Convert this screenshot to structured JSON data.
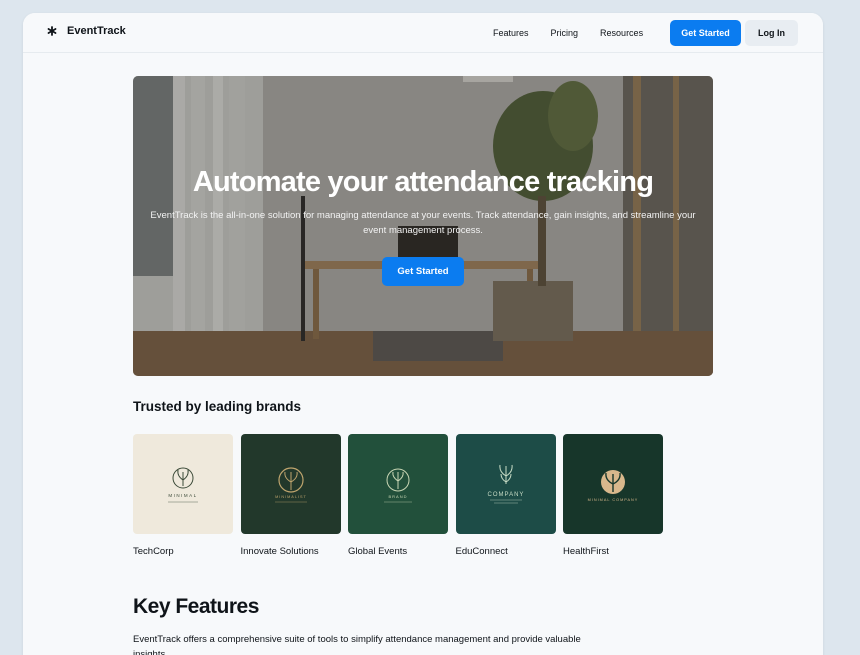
{
  "app": {
    "name": "EventTrack"
  },
  "nav": {
    "links": [
      "Features",
      "Pricing",
      "Resources"
    ],
    "primary_cta": "Get Started",
    "login": "Log In"
  },
  "hero": {
    "title": "Automate your attendance tracking",
    "subtitle": "EventTrack is the all-in-one solution for managing attendance at your events. Track attendance, gain insights, and streamline your event management process.",
    "cta": "Get Started"
  },
  "brands": {
    "heading": "Trusted by leading brands",
    "items": [
      {
        "name": "TechCorp",
        "tile_color": "#efe9dc",
        "logo_text": "MINIMAL",
        "logo_color": "#3b4a38"
      },
      {
        "name": "Innovate Solutions",
        "tile_color": "#22382b",
        "logo_text": "MINIMALIST",
        "logo_color": "#bfa56e"
      },
      {
        "name": "Global Events",
        "tile_color": "#22503b",
        "logo_text": "BRAND",
        "logo_color": "#c8d6b4"
      },
      {
        "name": "EduConnect",
        "tile_color": "#1d4c47",
        "logo_text": "COMPANY",
        "logo_color": "#c8dcc6"
      },
      {
        "name": "HealthFirst",
        "tile_color": "#17362a",
        "logo_text": "MINIMAL COMPANY",
        "logo_color": "#d8b88c"
      }
    ]
  },
  "features": {
    "heading": "Key Features",
    "description": "EventTrack offers a comprehensive suite of tools to simplify attendance management and provide valuable insights."
  },
  "colors": {
    "accent": "#0b7cf0",
    "page_bg": "#dde6ee",
    "window_bg": "#f7f9fb"
  },
  "icons": {
    "brand": "asterisk-icon"
  }
}
